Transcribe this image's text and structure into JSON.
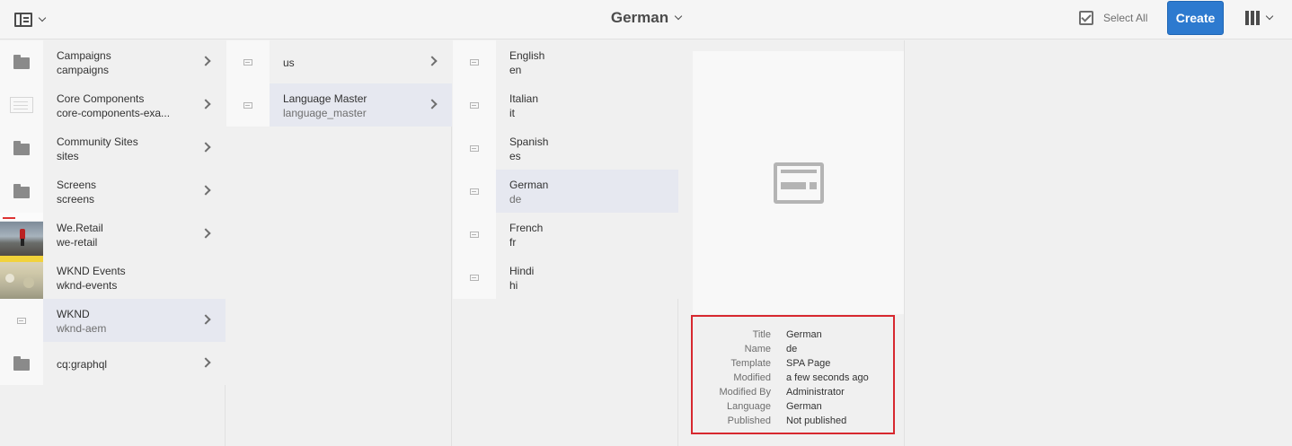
{
  "header": {
    "title": "German",
    "select_all_label": "Select All",
    "create_label": "Create"
  },
  "columns": [
    {
      "items": [
        {
          "title": "Campaigns",
          "name": "campaigns",
          "icon": "folder-icon",
          "has_children": true,
          "selected": false
        },
        {
          "title": "Core Components",
          "name": "core-components-exa...",
          "icon": "core-components-icon",
          "has_children": true,
          "selected": false
        },
        {
          "title": "Community Sites",
          "name": "sites",
          "icon": "folder-icon",
          "has_children": true,
          "selected": false
        },
        {
          "title": "Screens",
          "name": "screens",
          "icon": "folder-icon",
          "has_children": true,
          "selected": false
        },
        {
          "title": "We.Retail",
          "name": "we-retail",
          "icon": "we-retail-thumbnail",
          "has_children": true,
          "selected": false
        },
        {
          "title": "WKND Events",
          "name": "wknd-events",
          "icon": "wknd-events-thumbnail",
          "has_children": false,
          "selected": false
        },
        {
          "title": "WKND",
          "name": "wknd-aem",
          "icon": "page-icon",
          "has_children": true,
          "selected": true
        },
        {
          "title": "cq:graphql",
          "name": "",
          "icon": "folder-icon",
          "has_children": true,
          "selected": false
        }
      ]
    },
    {
      "items": [
        {
          "title": "us",
          "name": "",
          "icon": "page-icon",
          "has_children": true,
          "selected": false
        },
        {
          "title": "Language Master",
          "name": "language_master",
          "icon": "page-icon",
          "has_children": true,
          "selected": true
        }
      ]
    },
    {
      "items": [
        {
          "title": "English",
          "name": "en",
          "icon": "page-icon",
          "selected": false
        },
        {
          "title": "Italian",
          "name": "it",
          "icon": "page-icon",
          "selected": false
        },
        {
          "title": "Spanish",
          "name": "es",
          "icon": "page-icon",
          "selected": false
        },
        {
          "title": "German",
          "name": "de",
          "icon": "page-icon",
          "selected": true
        },
        {
          "title": "French",
          "name": "fr",
          "icon": "page-icon",
          "selected": false
        },
        {
          "title": "Hindi",
          "name": "hi",
          "icon": "page-icon",
          "selected": false
        }
      ]
    }
  ],
  "preview": {
    "icon": "page-template-icon",
    "meta": [
      {
        "key": "Title",
        "value": "German"
      },
      {
        "key": "Name",
        "value": "de"
      },
      {
        "key": "Template",
        "value": "SPA Page"
      },
      {
        "key": "Modified",
        "value": "a few seconds ago"
      },
      {
        "key": "Modified By",
        "value": "Administrator"
      },
      {
        "key": "Language",
        "value": "German"
      },
      {
        "key": "Published",
        "value": "Not published"
      }
    ]
  },
  "colors": {
    "accent": "#2d7acf",
    "highlight_border": "#d7282f",
    "selected_row": "#e6e8f0"
  }
}
